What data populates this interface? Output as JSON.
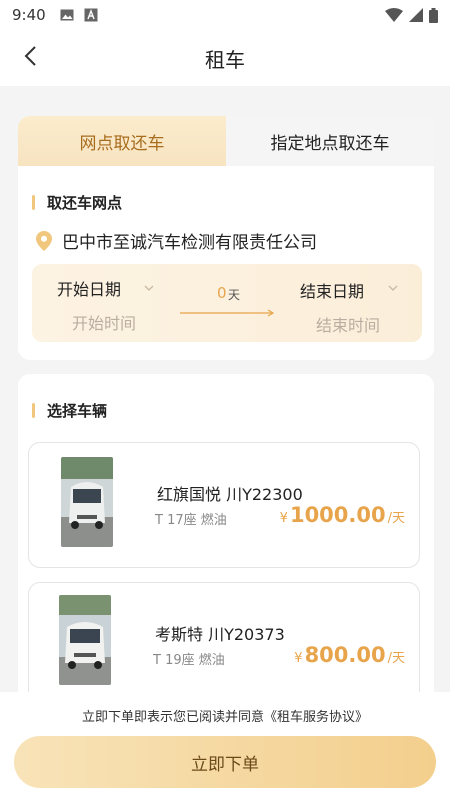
{
  "status_bar": {
    "time": "9:40"
  },
  "nav": {
    "title": "租车"
  },
  "tabs": [
    {
      "label": "网点取还车",
      "active": true
    },
    {
      "label": "指定地点取还车",
      "active": false
    }
  ],
  "pickup": {
    "section_title": "取还车网点",
    "location": "巴中市至诚汽车检测有限责任公司",
    "start_label": "开始日期",
    "start_placeholder": "开始时间",
    "end_label": "结束日期",
    "end_placeholder": "结束时间",
    "days_value": "0",
    "days_unit": "天"
  },
  "vehicles": {
    "section_title": "选择车辆",
    "items": [
      {
        "name": "红旗国悦 川Y22300",
        "spec": "T 17座 燃油",
        "currency": "¥",
        "price": "1000.00",
        "unit": "/天"
      },
      {
        "name": "考斯特 川Y20373",
        "spec": "T 19座 燃油",
        "currency": "¥",
        "price": "800.00",
        "unit": "/天"
      }
    ]
  },
  "footer": {
    "agreement_text": "立即下单即表示您已阅读并同意",
    "agreement_link": "《租车服务协议》",
    "order_button": "立即下单"
  },
  "colors": {
    "accent": "#e8a44a",
    "tab_active_bg": "#fbeccd",
    "button_bg": "#f3cf8d"
  }
}
